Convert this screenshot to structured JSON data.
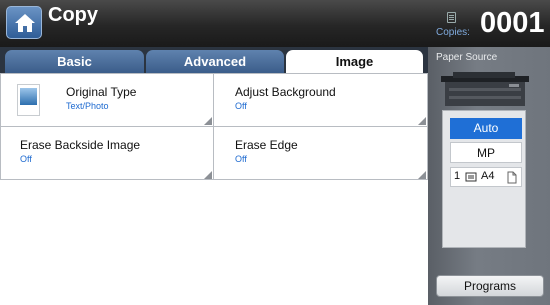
{
  "header": {
    "title": "Copy",
    "copies_label": "Copies:",
    "copies_value": "0001"
  },
  "tabs": [
    {
      "label": "Basic",
      "active": false
    },
    {
      "label": "Advanced",
      "active": false
    },
    {
      "label": "Image",
      "active": true
    }
  ],
  "options": [
    {
      "label": "Original Type",
      "value": "Text/Photo"
    },
    {
      "label": "Adjust Background",
      "value": "Off"
    },
    {
      "label": "Erase Backside Image",
      "value": "Off"
    },
    {
      "label": "Erase Edge",
      "value": "Off"
    }
  ],
  "paper_source": {
    "label": "Paper Source",
    "options": [
      "Auto",
      "MP"
    ],
    "selected": "Auto",
    "tray": {
      "number": "1",
      "size": "A4"
    }
  },
  "programs_label": "Programs",
  "colors": {
    "accent": "#1f6fd6",
    "header": "#262626",
    "tab": "#4a6f9e"
  },
  "icons": [
    "home-icon",
    "copies-icon",
    "paper-stack-icon",
    "page-icon"
  ]
}
